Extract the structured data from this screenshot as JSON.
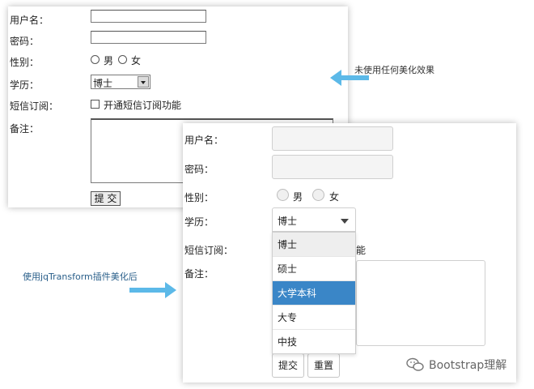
{
  "plain_form": {
    "labels": {
      "username": "用户名：",
      "password": "密码：",
      "gender": "性别：",
      "education": "学历：",
      "sms": "短信订阅：",
      "note": "备注："
    },
    "gender_options": [
      "男",
      "女"
    ],
    "education_value": "博士",
    "sms_option": "开通短信订阅功能",
    "submit_label": "提 交"
  },
  "styled_form": {
    "labels": {
      "username": "用户名：",
      "password": "密码：",
      "gender": "性别：",
      "education": "学历：",
      "sms": "短信订阅：",
      "note": "备注："
    },
    "gender_options": [
      "男",
      "女"
    ],
    "education_value": "博士",
    "education_options": [
      "博士",
      "硕士",
      "大学本科",
      "大专",
      "中技"
    ],
    "selected_option": "大学本科",
    "sms_option_fragment": "能",
    "submit_label": "提交",
    "reset_label": "重置"
  },
  "annotations": {
    "before": "未使用任何美化效果",
    "after": "使用jqTransform插件美化后"
  },
  "watermark": "Bootstrap理解",
  "colors": {
    "arrow": "#5cb9e8",
    "selected_option_bg": "#3a86c7"
  }
}
